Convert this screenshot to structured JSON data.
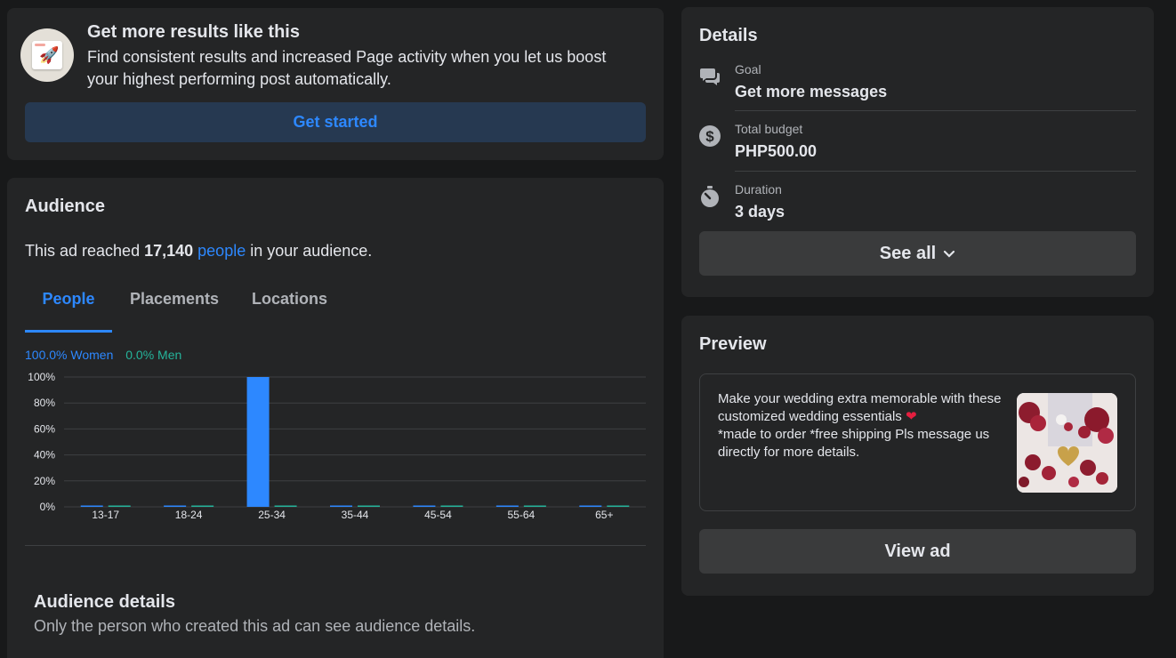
{
  "boost": {
    "title": "Get more results like this",
    "description": "Find consistent results and increased Page activity when you let us boost your highest performing post automatically.",
    "cta_label": "Get started",
    "icon": "rocket-icon"
  },
  "audience": {
    "title": "Audience",
    "reach_prefix": "This ad reached ",
    "reach_count": "17,140",
    "reach_link": "people",
    "reach_suffix": " in your audience.",
    "tabs": [
      "People",
      "Placements",
      "Locations"
    ],
    "active_tab": "People",
    "legend_women": "100.0% Women",
    "legend_men": "0.0% Men",
    "details_title": "Audience details",
    "details_text": "Only the person who created this ad can see audience details."
  },
  "chart_data": {
    "type": "bar",
    "categories": [
      "13-17",
      "18-24",
      "25-34",
      "35-44",
      "45-54",
      "55-64",
      "65+"
    ],
    "series": [
      {
        "name": "Women",
        "values": [
          0,
          0,
          100,
          0,
          0,
          0,
          0
        ],
        "color": "#2d88ff"
      },
      {
        "name": "Men",
        "values": [
          0,
          0,
          0,
          0,
          0,
          0,
          0
        ],
        "color": "#25b49b"
      }
    ],
    "yticks": [
      "0%",
      "20%",
      "40%",
      "60%",
      "80%",
      "100%"
    ],
    "ylim": [
      0,
      100
    ],
    "grid": true,
    "title": "",
    "xlabel": "",
    "ylabel": ""
  },
  "details": {
    "title": "Details",
    "rows": [
      {
        "label": "Goal",
        "value": "Get more messages",
        "icon": "messages-icon"
      },
      {
        "label": "Total budget",
        "value": "PHP500.00",
        "icon": "dollar-icon"
      },
      {
        "label": "Duration",
        "value": "3 days",
        "icon": "stopwatch-icon"
      }
    ],
    "see_all_label": "See all"
  },
  "preview": {
    "title": "Preview",
    "ad_text_1": "Make your wedding extra memorable with these customized wedding essentials ",
    "ad_text_2": "*made to order *free shipping Pls message us directly for more details.",
    "view_ad_label": "View ad"
  },
  "colors": {
    "background": "#18191a",
    "card": "#242526",
    "accent": "#2d88ff",
    "men": "#25b49b"
  }
}
